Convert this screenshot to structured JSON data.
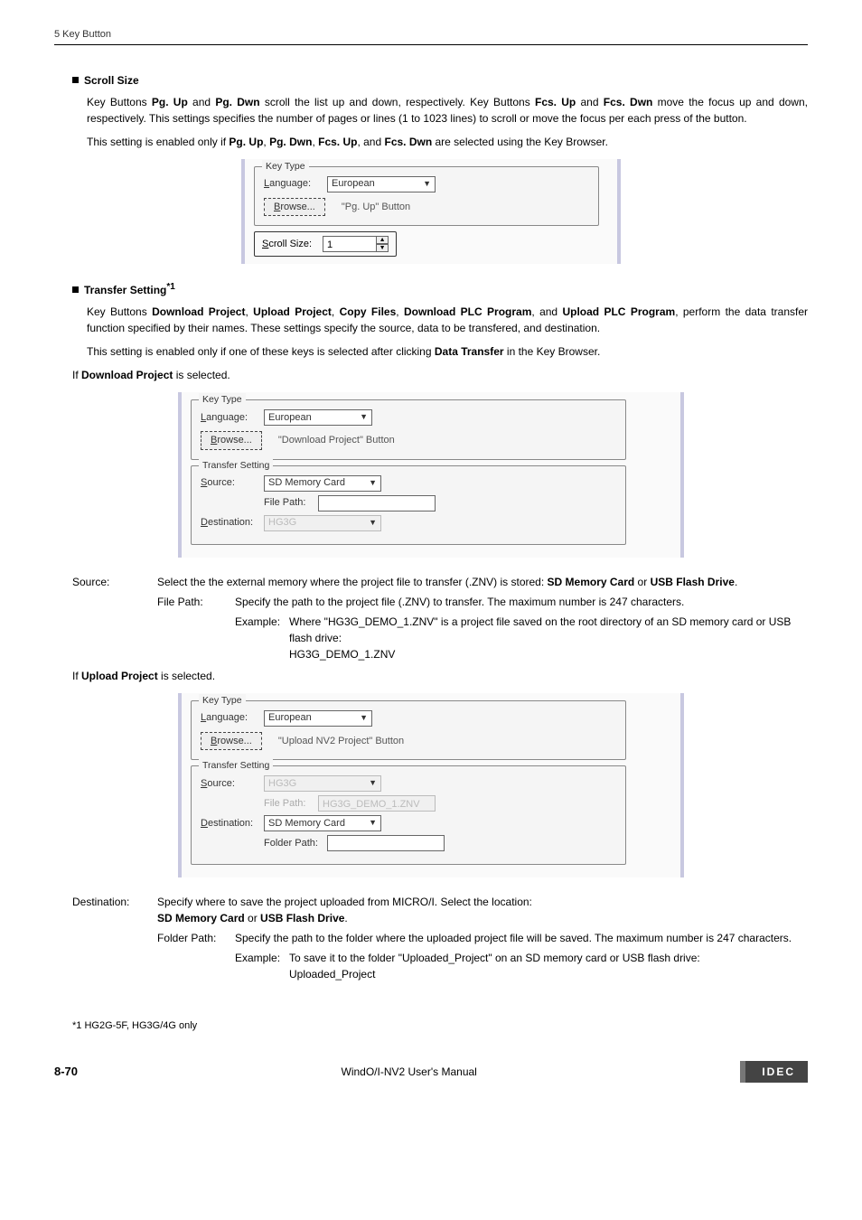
{
  "header": {
    "chapter": "5 Key Button"
  },
  "scrollSize": {
    "title": "Scroll Size",
    "p1_before": "Key Buttons ",
    "p1_b1": "Pg. Up",
    "p1_mid1": " and ",
    "p1_b2": "Pg. Dwn",
    "p1_mid2": " scroll the list up and down, respectively. Key Buttons ",
    "p1_b3": "Fcs. Up",
    "p1_mid3": " and ",
    "p1_b4": "Fcs. Dwn",
    "p1_after": " move the focus up and down, respectively. This settings specifies the number of pages or lines (1 to 1023 lines) to scroll or move the focus per each press of the button.",
    "p2_before": "This setting is enabled only if ",
    "p2_b1": "Pg. Up",
    "p2_c1": ", ",
    "p2_b2": "Pg. Dwn",
    "p2_c2": ", ",
    "p2_b3": "Fcs. Up",
    "p2_c3": ", and ",
    "p2_b4": "Fcs. Dwn",
    "p2_after": " are selected using the Key Browser."
  },
  "dlg1": {
    "legend": "Key Type",
    "langLabel": "Language:",
    "langValue": "European",
    "browse": "Browse...",
    "keyLabel": "\"Pg. Up\"  Button",
    "scrollLabel": "Scroll Size:",
    "scrollVal": "1"
  },
  "transfer": {
    "title": "Transfer Setting",
    "sup": "*1",
    "p1_before": "Key Buttons ",
    "p1_b1": "Download Project",
    "p1_c1": ", ",
    "p1_b2": "Upload Project",
    "p1_c2": ", ",
    "p1_b3": "Copy Files",
    "p1_c3": ", ",
    "p1_b4": "Download PLC Program",
    "p1_c4": ", and ",
    "p1_b5": "Upload PLC Program",
    "p1_after": ", perform the data transfer function specified by their names. These settings specify the source, data to be transfered, and destination.",
    "p2_before": "This setting is enabled only if one of these keys is selected after clicking ",
    "p2_b1": "Data Transfer",
    "p2_after": " in the Key Browser.",
    "ifDownload_before": "If ",
    "ifDownload_b": "Download Project",
    "ifDownload_after": " is selected.",
    "ifUpload_before": "If ",
    "ifUpload_b": "Upload Project",
    "ifUpload_after": " is selected."
  },
  "dlg2": {
    "legend": "Key Type",
    "langLabel": "Language:",
    "langValue": "European",
    "browse": "Browse...",
    "keyLabel": "\"Download Project\"  Button",
    "tsLegend": "Transfer Setting",
    "sourceLabel": "Source:",
    "sourceValue": "SD Memory Card",
    "filePathLabel": "File Path:",
    "destLabel": "Destination:",
    "destValue": "HG3G"
  },
  "def1": {
    "sourceTerm": "Source:",
    "sourceBody_before": "Select the the external memory where the project file to transfer (.ZNV) is stored: ",
    "sourceBody_b1": "SD Memory Card",
    "sourceBody_mid": " or ",
    "sourceBody_b2": "USB Flash Drive",
    "sourceBody_after": ".",
    "filePathTerm": "File Path:",
    "filePathBody": "Specify the path to the project file (.ZNV) to transfer. The maximum number is 247 characters.",
    "exTerm": "Example:",
    "exBody1": "Where \"HG3G_DEMO_1.ZNV\" is a project file saved on the root directory of an SD memory card or USB flash drive:",
    "exBody2": "HG3G_DEMO_1.ZNV"
  },
  "dlg3": {
    "legend": "Key Type",
    "langLabel": "Language:",
    "langValue": "European",
    "browse": "Browse...",
    "keyLabel": "\"Upload NV2 Project\"  Button",
    "tsLegend": "Transfer Setting",
    "sourceLabel": "Source:",
    "sourceValue": "HG3G",
    "filePathLabel": "File Path:",
    "filePathValue": "HG3G_DEMO_1.ZNV",
    "destLabel": "Destination:",
    "destValue": "SD Memory Card",
    "folderPathLabel": "Folder Path:"
  },
  "def2": {
    "destTerm": "Destination:",
    "destBody1": "Specify where to save the project uploaded from MICRO/I. Select the location:",
    "destBody2_b1": "SD Memory Card",
    "destBody2_mid": " or ",
    "destBody2_b2": "USB Flash Drive",
    "destBody2_after": ".",
    "folderPathTerm": "Folder Path:",
    "folderPathBody": "Specify the path to the folder where the uploaded project file will be saved. The maximum number is 247 characters.",
    "exTerm": "Example:",
    "exBody1": "To save it to the folder \"Uploaded_Project\" on an SD memory card or USB flash drive:",
    "exBody2": "Uploaded_Project"
  },
  "footnote": "*1  HG2G-5F, HG3G/4G only",
  "footer": {
    "page": "8-70",
    "center": "WindO/I-NV2 User's Manual",
    "brand": "IDEC"
  }
}
